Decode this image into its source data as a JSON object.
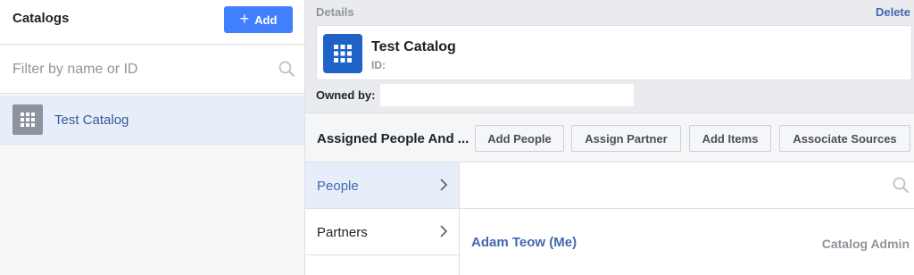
{
  "left": {
    "title": "Catalogs",
    "add_button": "Add",
    "filter_placeholder": "Filter by name or ID",
    "catalogs": [
      {
        "name": "Test Catalog",
        "icon": "grid-icon"
      }
    ]
  },
  "details": {
    "label": "Details",
    "delete_link": "Delete",
    "catalog_title": "Test Catalog",
    "id_label": "ID:",
    "owned_by_label": "Owned by:"
  },
  "assigned": {
    "title": "Assigned People And ...",
    "buttons": [
      "Add People",
      "Assign Partner",
      "Add Items",
      "Associate Sources"
    ]
  },
  "tabs": [
    {
      "label": "People",
      "active": true
    },
    {
      "label": "Partners",
      "active": false
    }
  ],
  "people": [
    {
      "name": "Adam Teow (Me)",
      "role": "Catalog Admin"
    }
  ],
  "colors": {
    "primary": "#4080ff",
    "link": "#4267b2",
    "catalog_icon": "#1e62c8",
    "active_row": "#e7eef9"
  }
}
